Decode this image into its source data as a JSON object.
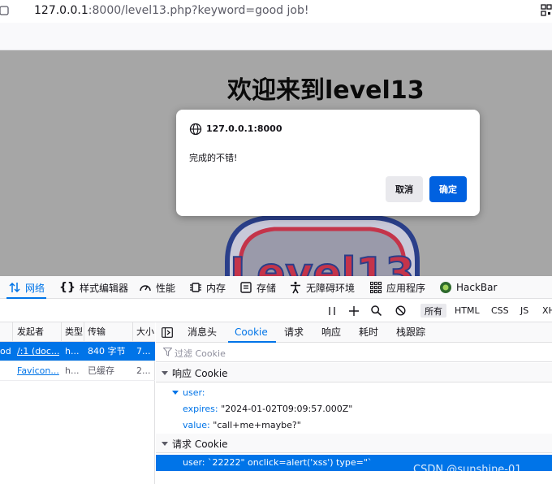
{
  "browser": {
    "url_host": "127.0.0.1",
    "url_rest": ":8000/level13.php?keyword=good job!"
  },
  "page": {
    "heading": "欢迎来到level13"
  },
  "dialog": {
    "origin": "127.0.0.1:8000",
    "message": "完成的不错!",
    "cancel_label": "取消",
    "ok_label": "确定"
  },
  "devtools": {
    "tabs": [
      {
        "label": "网络",
        "icon": "network-arrows-icon"
      },
      {
        "label": "样式编辑器",
        "icon": "braces-icon"
      },
      {
        "label": "性能",
        "icon": "gauge-icon"
      },
      {
        "label": "内存",
        "icon": "memory-icon"
      },
      {
        "label": "存储",
        "icon": "storage-icon"
      },
      {
        "label": "无障碍环境",
        "icon": "accessibility-icon"
      },
      {
        "label": "应用程序",
        "icon": "grid-icon"
      },
      {
        "label": "HackBar",
        "icon": "hackbar-icon"
      }
    ],
    "filters": [
      "所有",
      "HTML",
      "CSS",
      "JS",
      "XH"
    ],
    "columns": [
      "发起者",
      "类型",
      "传输",
      "大小"
    ],
    "rows": [
      {
        "prefix": "od",
        "initiator": "/:1 (doc...",
        "type": "h...",
        "transfer": "840 字节",
        "size": "7..."
      },
      {
        "prefix": "",
        "initiator": "Favicon...",
        "type": "h...",
        "transfer": "已缓存",
        "size": "2..."
      }
    ],
    "detail_tabs": [
      "消息头",
      "Cookie",
      "请求",
      "响应",
      "耗时",
      "栈跟踪"
    ],
    "cookie_filter_placeholder": "过滤 Cookie",
    "response_section": "响应 Cookie",
    "response_cookie_name": "user:",
    "expires_key": "expires:",
    "expires_value": "\"2024-01-02T09:09:57.000Z\"",
    "value_key": "value:",
    "value_value": "\"call+me+maybe?\"",
    "request_section": "请求 Cookie",
    "request_cookie": "user: `22222\" onclick=alert('xss') type=\"`"
  },
  "watermark": "CSDN @sunshine-01",
  "colors": {
    "accent": "#0074e8",
    "dialog_ok": "#0061e0",
    "page_dim": "#a6a6a6"
  }
}
